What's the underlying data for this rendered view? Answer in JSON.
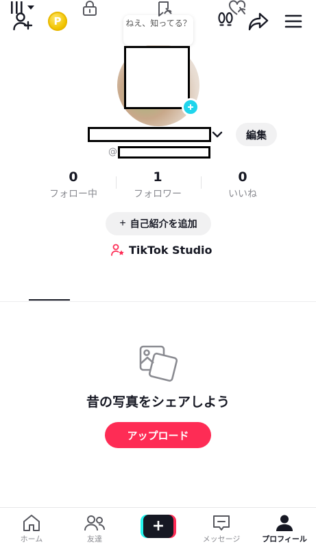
{
  "top_bar": {
    "icons": [
      "add-friend-icon",
      "coin-icon",
      "footprints-icon",
      "share-icon",
      "menu-icon"
    ],
    "coin_symbol": "P"
  },
  "profile": {
    "bubble_text": "ねえ、知ってる？",
    "edit_label": "編集",
    "at_prefix": "@"
  },
  "stats": [
    {
      "value": "0",
      "label": "フォロー中"
    },
    {
      "value": "1",
      "label": "フォロワー"
    },
    {
      "value": "0",
      "label": "いいね"
    }
  ],
  "bio_button": {
    "plus": "+",
    "label": "自己紹介を追加"
  },
  "studio_link": {
    "label": "TikTok Studio"
  },
  "tabs": [
    "videos-grid-icon",
    "lock-icon",
    "repost-icon",
    "liked-icon"
  ],
  "empty_state": {
    "title": "昔の写真をシェアしよう",
    "button_label": "アップロード"
  },
  "bottom_nav": {
    "home": "ホーム",
    "friends": "友達",
    "create": "+",
    "messages": "メッセージ",
    "profile": "プロフィール"
  },
  "colors": {
    "accent": "#fe2c55",
    "cyan": "#25f4ee",
    "text": "#161823",
    "muted": "#8a8b91"
  }
}
